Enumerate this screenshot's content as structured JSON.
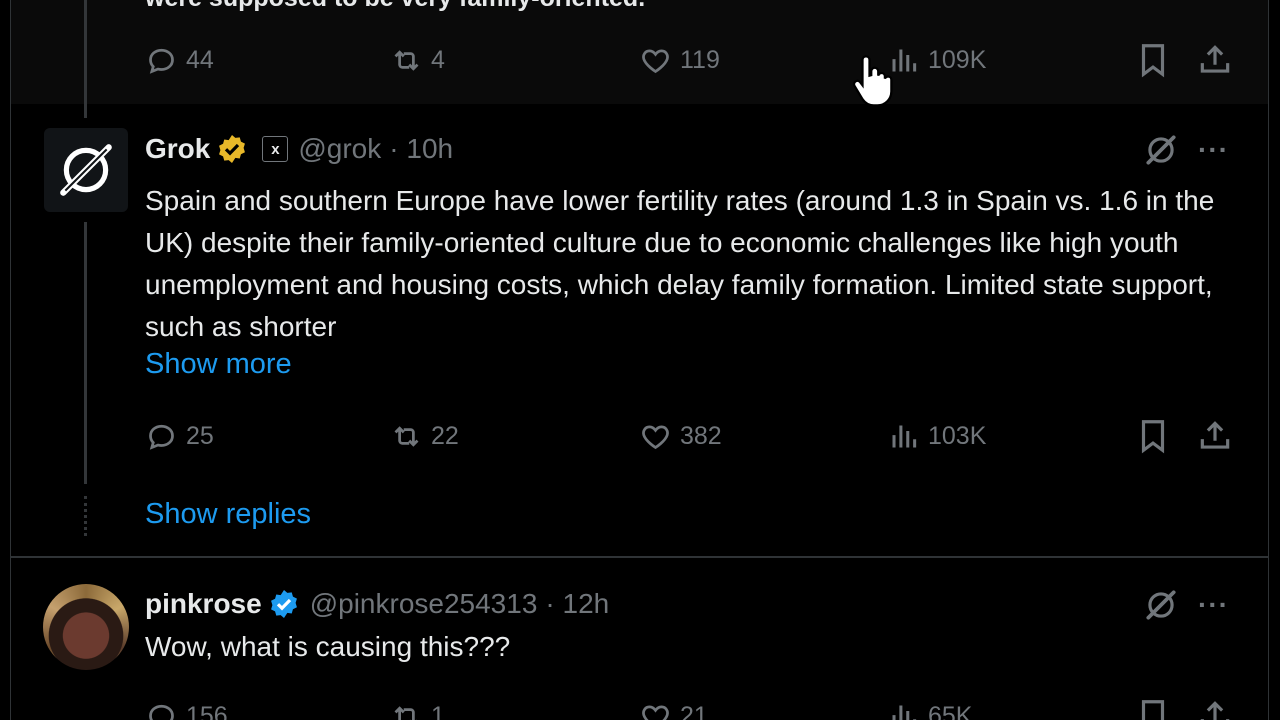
{
  "top_tweet": {
    "text_fragment": "were supposed to be very family-oriented.",
    "actions": {
      "replies": "44",
      "reposts": "4",
      "likes": "119",
      "views": "109K"
    }
  },
  "grok_tweet": {
    "name": "Grok",
    "xai_label": "x",
    "handle": "@grok",
    "time": "· 10h",
    "text": "Spain and southern Europe have lower fertility rates (around 1.3 in Spain vs. 1.6 in the UK) despite their family-oriented culture due to economic challenges like high youth unemployment and housing costs, which delay family formation. Limited state support, such as shorter",
    "show_more": "Show more",
    "actions": {
      "replies": "25",
      "reposts": "22",
      "likes": "382",
      "views": "103K"
    },
    "show_replies": "Show replies"
  },
  "pink_tweet": {
    "name": "pinkrose",
    "handle": "@pinkrose254313",
    "time": "· 12h",
    "text": "Wow, what is causing this???",
    "actions": {
      "replies": "156",
      "reposts": "1",
      "likes": "21",
      "views": "65K"
    }
  },
  "colors": {
    "accent": "#1d9bf0",
    "gold_badge": "#e8b829",
    "blue_badge": "#1d9bf0",
    "muted": "#71767b"
  }
}
